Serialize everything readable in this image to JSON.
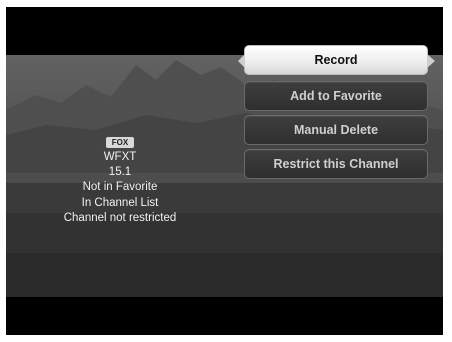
{
  "channel": {
    "logo": "FOX",
    "call_sign": "WFXT",
    "number": "15.1",
    "favorite_status": "Not in Favorite",
    "list_status": "In Channel List",
    "restriction_status": "Channel not restricted"
  },
  "menu": {
    "items": [
      {
        "label": "Record",
        "selected": true
      },
      {
        "label": "Add to Favorite",
        "selected": false
      },
      {
        "label": "Manual Delete",
        "selected": false
      },
      {
        "label": "Restrict this Channel",
        "selected": false
      }
    ]
  },
  "colors": {
    "selected_bg": "#ffffff",
    "item_bg": "#333333",
    "text": "#f2f2f2"
  },
  "icons": {
    "selection_arrows": "triangle-arrow-icon"
  }
}
